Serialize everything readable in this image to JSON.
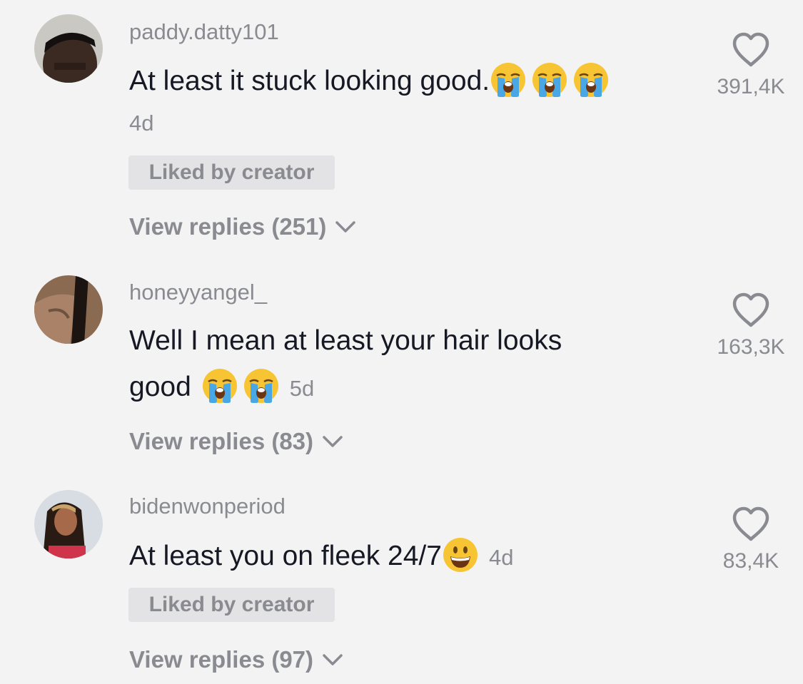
{
  "comments": [
    {
      "username": "paddy.datty101",
      "text": "At least it stuck looking good.",
      "emojis": [
        "loudly-crying-face",
        "loudly-crying-face",
        "loudly-crying-face"
      ],
      "time": "4d",
      "badge": "Liked by creator",
      "replies": "View replies (251)",
      "likes": "391,4K"
    },
    {
      "username": "honeyyangel_",
      "text_line1": "Well I mean at least your hair looks",
      "text_line2": "good",
      "emojis": [
        "loudly-crying-face",
        "loudly-crying-face"
      ],
      "time": "5d",
      "replies": "View replies (83)",
      "likes": "163,3K"
    },
    {
      "username": "bidenwonperiod",
      "text": "At least you on fleek 24/7",
      "emojis": [
        "smiling-face-open-mouth"
      ],
      "time": "4d",
      "badge": "Liked by creator",
      "replies": "View replies (97)",
      "likes": "83,4K"
    }
  ],
  "icons": {
    "like": "heart-outline-icon",
    "expand": "chevron-down-icon"
  },
  "colors": {
    "background": "#f3f3f4",
    "primary_text": "#161823",
    "secondary_text": "#8a8b91",
    "badge_bg": "#e3e3e5"
  }
}
